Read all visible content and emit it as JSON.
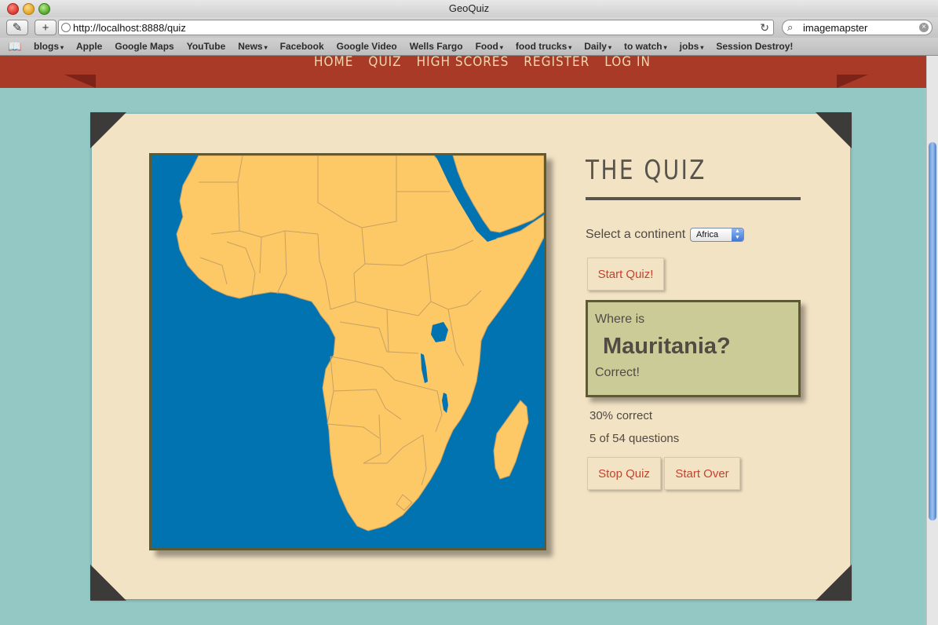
{
  "window": {
    "title": "GeoQuiz"
  },
  "toolbar": {
    "url": "http://localhost:8888/quiz",
    "search_value": "imagemapster",
    "edit_icon": "✎",
    "add_icon": "+",
    "reload_icon": "↻",
    "search_icon": "⌕",
    "clear_icon": "×"
  },
  "bookmarks": {
    "book_icon": "📖",
    "items": [
      {
        "label": "blogs",
        "menu": "▾"
      },
      {
        "label": "Apple",
        "menu": ""
      },
      {
        "label": "Google Maps",
        "menu": ""
      },
      {
        "label": "YouTube",
        "menu": ""
      },
      {
        "label": "News",
        "menu": "▾"
      },
      {
        "label": "Facebook",
        "menu": ""
      },
      {
        "label": "Google Video",
        "menu": ""
      },
      {
        "label": "Wells Fargo",
        "menu": ""
      },
      {
        "label": "Food",
        "menu": "▾"
      },
      {
        "label": "food trucks",
        "menu": "▾"
      },
      {
        "label": "Daily",
        "menu": "▾"
      },
      {
        "label": "to watch",
        "menu": "▾"
      },
      {
        "label": "jobs",
        "menu": "▾"
      },
      {
        "label": "Session Destroy!",
        "menu": ""
      }
    ]
  },
  "nav": {
    "home": "HOME",
    "quiz": "QUIZ",
    "high_scores": "HIGH SCORES",
    "register": "REGISTER",
    "login": "LOG IN"
  },
  "quiz": {
    "title": "THE QUIZ",
    "continent_label": "Select a continent",
    "continent_value": "Africa",
    "start_label": "Start Quiz!",
    "question_prompt": "Where is",
    "question_country": "Mauritania?",
    "feedback": "Correct!",
    "percent_correct": "30% correct",
    "question_count": "5 of 54 questions",
    "stop_label": "Stop Quiz",
    "start_over_label": "Start Over"
  },
  "colors": {
    "ocean": "#0273b1",
    "land": "#fcc966",
    "border": "#c8a062",
    "nav": "#a93a28",
    "card": "#f3e3c5",
    "question_box": "#cbcb97"
  }
}
